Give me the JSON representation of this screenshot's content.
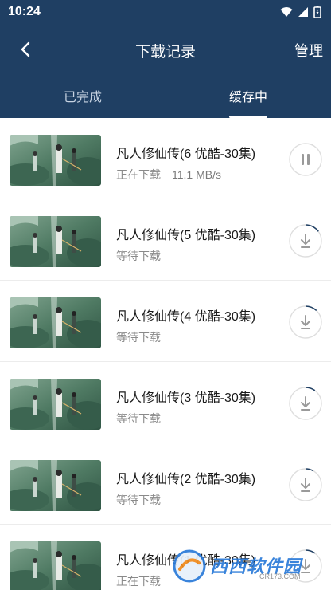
{
  "status_bar": {
    "time": "10:24"
  },
  "header": {
    "title": "下载记录",
    "manage_label": "管理"
  },
  "tabs": [
    {
      "label": "已完成",
      "active": false
    },
    {
      "label": "缓存中",
      "active": true
    }
  ],
  "items": [
    {
      "title": "凡人修仙传(6 优酷-30集)",
      "status": "正在下载",
      "speed": "11.1 MB/s",
      "action_icon": "pause-icon",
      "progress": 0.0
    },
    {
      "title": "凡人修仙传(5 优酷-30集)",
      "status": "等待下载",
      "speed": "",
      "action_icon": "download-icon",
      "progress": 0.15
    },
    {
      "title": "凡人修仙传(4 优酷-30集)",
      "status": "等待下载",
      "speed": "",
      "action_icon": "download-icon",
      "progress": 0.12
    },
    {
      "title": "凡人修仙传(3 优酷-30集)",
      "status": "等待下载",
      "speed": "",
      "action_icon": "download-icon",
      "progress": 0.1
    },
    {
      "title": "凡人修仙传(2 优酷-30集)",
      "status": "等待下载",
      "speed": "",
      "action_icon": "download-icon",
      "progress": 0.08
    },
    {
      "title": "凡人修仙传(1 优酷-30集)",
      "status": "正在下载",
      "speed": "",
      "action_icon": "download-icon",
      "progress": 0.1
    }
  ],
  "watermark": {
    "text": "西西软件园",
    "sub": "CR173.COM"
  },
  "colors": {
    "header_bg": "#1f3f63",
    "accent": "#1f3f63"
  }
}
